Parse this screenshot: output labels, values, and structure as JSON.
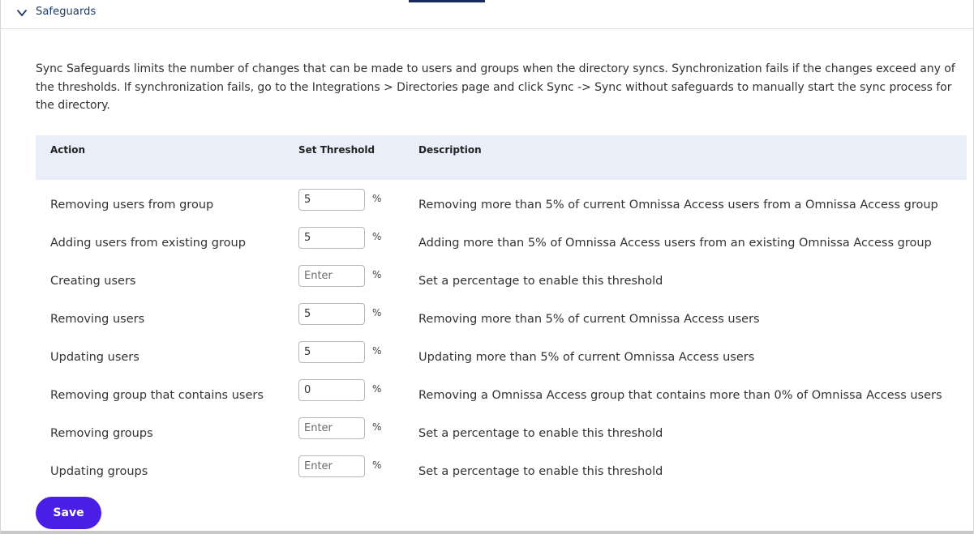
{
  "section": {
    "title": "Safeguards",
    "icon": "chevron-down-icon"
  },
  "intro_text": "Sync Safeguards limits the number of changes that can be made to users and groups when the directory syncs. Synchronization fails if the changes exceed any of the thresholds. If synchronization fails, go to the Integrations > Directories page and click Sync -> Sync without safeguards to manually start the sync process for the directory.",
  "table": {
    "headers": {
      "action": "Action",
      "threshold": "Set Threshold",
      "description": "Description"
    },
    "percent_symbol": "%",
    "rows": [
      {
        "action": "Removing users from group",
        "value": "5",
        "placeholder": "Enter",
        "description": "Removing more than 5% of current Omnissa Access users from a Omnissa Access group"
      },
      {
        "action": "Adding users from existing group",
        "value": "5",
        "placeholder": "Enter",
        "description": "Adding more than 5% of Omnissa Access users from an existing Omnissa Access group"
      },
      {
        "action": "Creating users",
        "value": "",
        "placeholder": "Enter",
        "description": "Set a percentage to enable this threshold"
      },
      {
        "action": "Removing users",
        "value": "5",
        "placeholder": "Enter",
        "description": "Removing more than 5% of current Omnissa Access users"
      },
      {
        "action": "Updating users",
        "value": "5",
        "placeholder": "Enter",
        "description": "Updating more than 5% of current Omnissa Access users"
      },
      {
        "action": "Removing group that contains users",
        "value": "0",
        "placeholder": "Enter",
        "description": "Removing a Omnissa Access group that contains more than 0% of Omnissa Access users"
      },
      {
        "action": "Removing groups",
        "value": "",
        "placeholder": "Enter",
        "description": "Set a percentage to enable this threshold"
      },
      {
        "action": "Updating groups",
        "value": "",
        "placeholder": "Enter",
        "description": "Set a percentage to enable this threshold"
      }
    ]
  },
  "save_label": "Save",
  "colors": {
    "accent": "#4b1ee6",
    "header_bg": "#e9eef9",
    "title": "#1b3a6b"
  }
}
